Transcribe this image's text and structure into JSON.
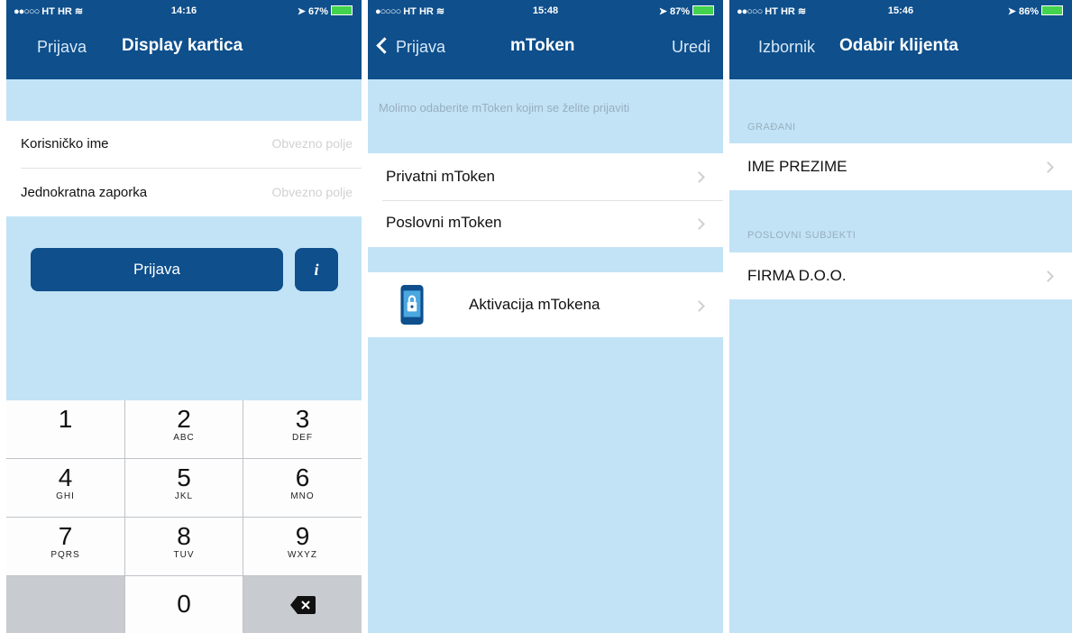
{
  "screens": [
    {
      "status": {
        "carrier": "HT HR",
        "time": "14:16",
        "battery": "67%"
      },
      "nav": {
        "left": "Prijava",
        "title": "Display kartica"
      },
      "form": {
        "username_label": "Korisničko ime",
        "username_placeholder": "Obvezno polje",
        "otp_label": "Jednokratna zaporka",
        "otp_placeholder": "Obvezno polje"
      },
      "login_button": "Prijava",
      "info_button": "i",
      "keypad": [
        {
          "num": "1",
          "letters": ""
        },
        {
          "num": "2",
          "letters": "ABC"
        },
        {
          "num": "3",
          "letters": "DEF"
        },
        {
          "num": "4",
          "letters": "GHI"
        },
        {
          "num": "5",
          "letters": "JKL"
        },
        {
          "num": "6",
          "letters": "MNO"
        },
        {
          "num": "7",
          "letters": "PQRS"
        },
        {
          "num": "8",
          "letters": "TUV"
        },
        {
          "num": "9",
          "letters": "WXYZ"
        },
        {
          "num": "0",
          "letters": ""
        }
      ]
    },
    {
      "status": {
        "carrier": "HT HR",
        "time": "15:48",
        "battery": "87%"
      },
      "nav": {
        "left": "Prijava",
        "title": "mToken",
        "right": "Uredi"
      },
      "hint": "Molimo odaberite mToken kojim se želite prijaviti",
      "items": [
        "Privatni mToken",
        "Poslovni mToken"
      ],
      "activation": "Aktivacija mTokena"
    },
    {
      "status": {
        "carrier": "HT HR",
        "time": "15:46",
        "battery": "86%"
      },
      "nav": {
        "left": "Izbornik",
        "title": "Odabir klijenta"
      },
      "section1": "GRAĐANI",
      "client1": "IME PREZIME",
      "section2": "POSLOVNI SUBJEKTI",
      "client2": "FIRMA D.O.O."
    }
  ],
  "colors": {
    "nav": "#0e4f8c",
    "background": "#c2e3f6",
    "battery": "#44d34e"
  },
  "icons": [
    "wifi-icon",
    "location-icon",
    "bluetooth-icon",
    "battery-icon",
    "chevron-right-icon",
    "backspace-icon",
    "phone-lock-icon"
  ]
}
